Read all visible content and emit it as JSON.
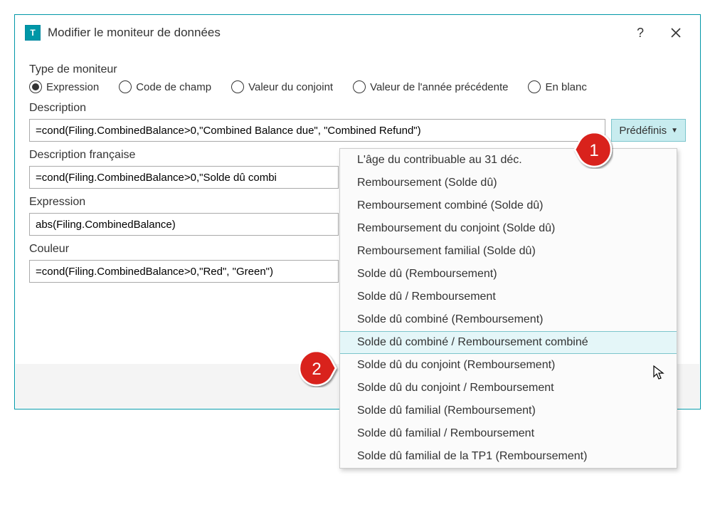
{
  "titlebar": {
    "title": "Modifier le moniteur de données",
    "help": "?",
    "close": "✕"
  },
  "monitor_type": {
    "label": "Type de moniteur",
    "options": [
      {
        "label": "Expression",
        "selected": true
      },
      {
        "label": "Code de champ",
        "selected": false
      },
      {
        "label": "Valeur du conjoint",
        "selected": false
      },
      {
        "label": "Valeur de l'année précédente",
        "selected": false
      },
      {
        "label": "En blanc",
        "selected": false
      }
    ]
  },
  "fields": {
    "description": {
      "label": "Description",
      "value": "=cond(Filing.CombinedBalance>0,\"Combined Balance due\", \"Combined Refund\")"
    },
    "description_fr": {
      "label": "Description française",
      "value": "=cond(Filing.CombinedBalance>0,\"Solde dû combi"
    },
    "expression": {
      "label": "Expression",
      "value": "abs(Filing.CombinedBalance)"
    },
    "color": {
      "label": "Couleur",
      "value": "=cond(Filing.CombinedBalance>0,\"Red\", \"Green\")"
    }
  },
  "presets": {
    "button_label": "Prédéfinis",
    "items": [
      "L'âge du contribuable au 31 déc.",
      "Remboursement (Solde dû)",
      "Remboursement combiné (Solde dû)",
      "Remboursement du conjoint (Solde dû)",
      "Remboursement familial (Solde dû)",
      "Solde dû (Remboursement)",
      "Solde dû / Remboursement",
      "Solde dû combiné (Remboursement)",
      "Solde dû combiné / Remboursement combiné",
      "Solde dû du conjoint (Remboursement)",
      "Solde dû du conjoint / Remboursement",
      "Solde dû familial (Remboursement)",
      "Solde dû familial / Remboursement",
      "Solde dû familial de la TP1 (Remboursement)"
    ],
    "highlighted_index": 8
  },
  "callouts": {
    "one": "1",
    "two": "2"
  }
}
